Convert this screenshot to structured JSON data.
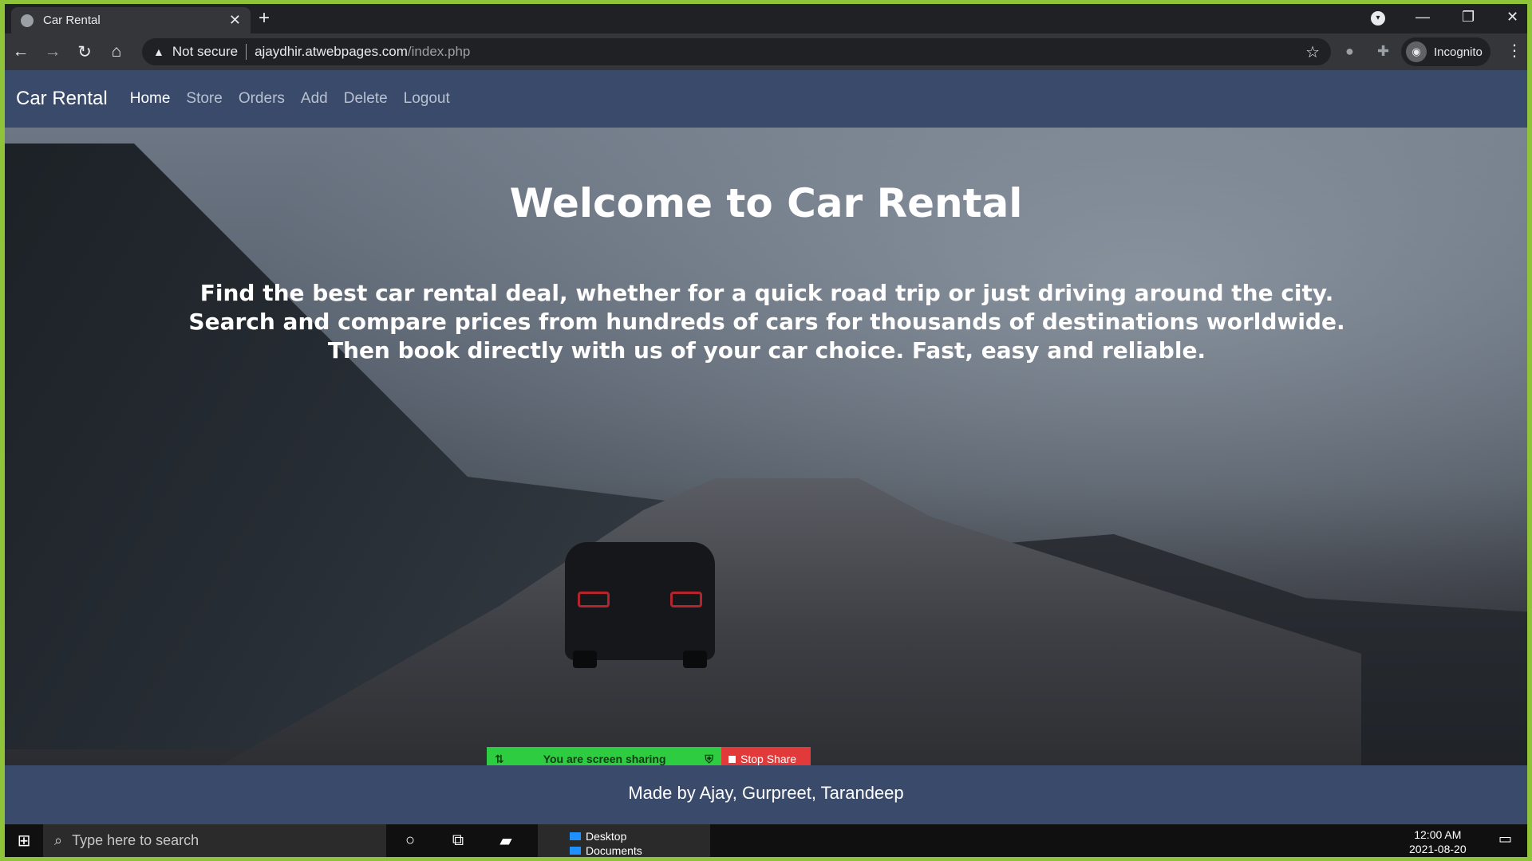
{
  "browser": {
    "tab_title": "Car Rental",
    "tab_close": "✕",
    "new_tab": "+",
    "security_label": "Not secure",
    "url_host": "ajaydhir.atwebpages.com",
    "url_path": "/index.php",
    "profile_label": "Incognito"
  },
  "site": {
    "brand": "Car Rental",
    "nav": [
      "Home",
      "Store",
      "Orders",
      "Add",
      "Delete",
      "Logout"
    ],
    "hero_title": "Welcome to Car Rental",
    "hero_text": "Find the best car rental deal, whether for a quick road trip or just driving around the city. Search and compare prices from hundreds of cars for thousands of destinations worldwide. Then book directly with us of your car choice. Fast, easy and reliable.",
    "footer": "Made by Ajay, Gurpreet, Tarandeep"
  },
  "share_bar": {
    "status": "You are screen sharing",
    "stop": "Stop Share"
  },
  "taskbar": {
    "search_placeholder": "Type here to search",
    "window_items": [
      "Desktop",
      "Documents"
    ],
    "time": "12:00 AM",
    "date": "2021-08-20"
  }
}
